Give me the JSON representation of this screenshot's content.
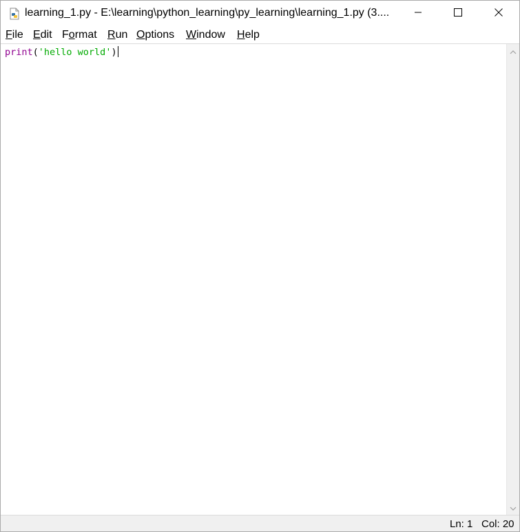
{
  "window": {
    "title": "learning_1.py - E:\\learning\\python_learning\\py_learning\\learning_1.py (3...."
  },
  "menu": {
    "file": {
      "first": "F",
      "rest": "ile"
    },
    "edit": {
      "first": "E",
      "rest": "dit"
    },
    "format": {
      "before": "F",
      "ul": "o",
      "after": "rmat"
    },
    "run": {
      "first": "R",
      "rest": "un"
    },
    "options": {
      "first": "O",
      "rest": "ptions"
    },
    "window": {
      "first": "W",
      "rest": "indow"
    },
    "help": {
      "first": "H",
      "rest": "elp"
    }
  },
  "editor": {
    "line1": {
      "builtin": "print",
      "open": "(",
      "string": "'hello world'",
      "close": ")"
    }
  },
  "status": {
    "ln": "Ln: 1",
    "col": "Col: 20"
  },
  "colors": {
    "builtin": "#900090",
    "string": "#00aa00",
    "statusbar_bg": "#f0f0f0"
  },
  "icons": {
    "app": "python-file-icon",
    "minimize": "minimize-icon",
    "maximize": "maximize-icon",
    "close": "close-icon",
    "scroll_up": "chevron-up-icon",
    "scroll_down": "chevron-down-icon"
  }
}
